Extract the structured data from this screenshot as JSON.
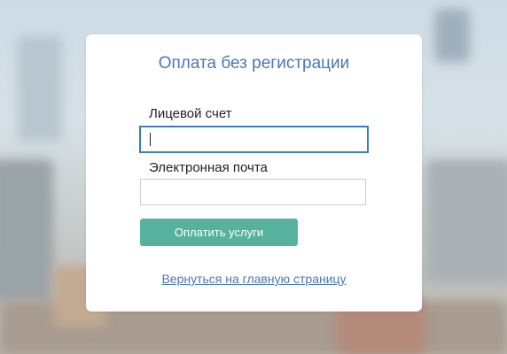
{
  "form": {
    "title": "Оплата без регистрации",
    "account_label": "Лицевой счет",
    "account_value": "",
    "email_label": "Электронная почта",
    "email_value": "",
    "submit_label": "Оплатить услуги",
    "back_link_label": "Вернуться на главную страницу"
  },
  "colors": {
    "accent": "#4a78b5",
    "button": "#56b29c",
    "focus_border": "#3b7bbf"
  }
}
